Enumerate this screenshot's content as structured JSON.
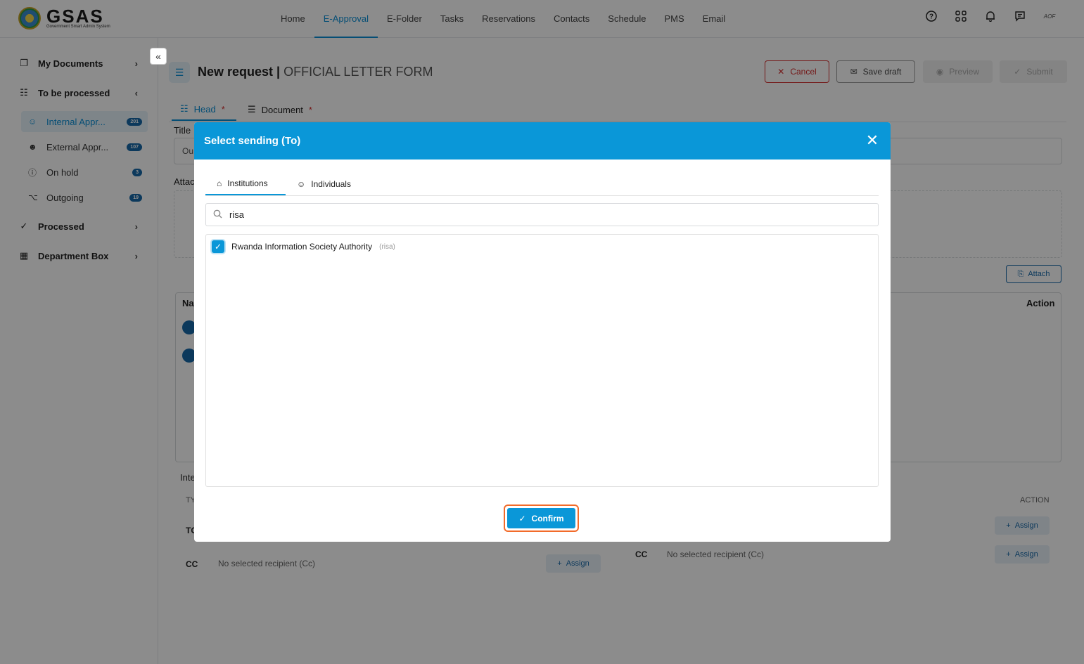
{
  "app": {
    "name": "GSAS",
    "subtitle": "Government Smart Admin System",
    "user_initials": "AOF"
  },
  "nav": [
    "Home",
    "E-Approval",
    "E-Folder",
    "Tasks",
    "Reservations",
    "Contacts",
    "Schedule",
    "PMS",
    "Email"
  ],
  "nav_active": "E-Approval",
  "top_icons": [
    "help-icon",
    "apps-icon",
    "bell-icon",
    "chat-icon"
  ],
  "sidebar": {
    "my_documents": "My Documents",
    "to_be_processed": "To be processed",
    "sub": [
      {
        "label": "Internal Appr...",
        "count": "201",
        "icon": "user-icon"
      },
      {
        "label": "External Appr...",
        "count": "107",
        "icon": "users-icon"
      },
      {
        "label": "On hold",
        "count": "3",
        "icon": "info-icon"
      },
      {
        "label": "Outgoing",
        "count": "19",
        "icon": "share-icon"
      }
    ],
    "processed": "Processed",
    "department_box": "Department Box"
  },
  "page": {
    "title": "New request |",
    "subtitle": "OFFICIAL LETTER FORM",
    "cancel": "Cancel",
    "save_draft": "Save draft",
    "preview": "Preview",
    "submit": "Submit",
    "tab_head": "Head",
    "tab_document": "Document",
    "required": "*",
    "title_label": "Title",
    "title_value_partial": "Ou",
    "attach_label": "Attac",
    "attach_button": "Attach",
    "name_header": "Na",
    "action_header": "Action",
    "internal_label": "Inte",
    "type_header": "TY",
    "action_header_small": "ACTION",
    "to_label": "TC",
    "cc_label": "CC",
    "no_recipient_cc": "No selected recipient (Cc)",
    "assign": "Assign"
  },
  "modal": {
    "title": "Select sending (To)",
    "tab_institutions": "Institutions",
    "tab_individuals": "Individuals",
    "search_value": "risa",
    "result_name": "Rwanda Information Society Authority",
    "result_abbr": "(risa)",
    "confirm": "Confirm"
  }
}
